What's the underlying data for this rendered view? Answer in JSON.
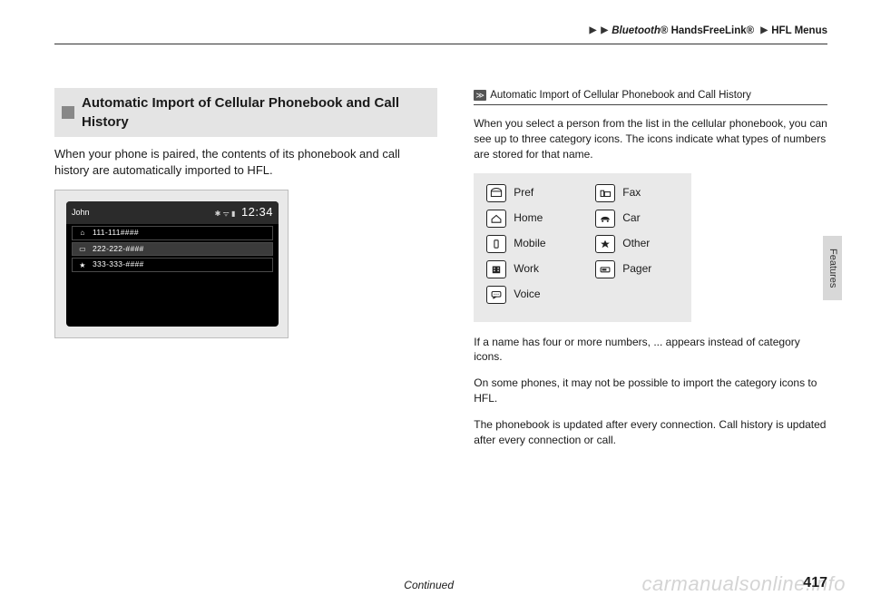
{
  "breadcrumb": {
    "a": "Bluetooth",
    "a_reg": "®",
    "b": "HandsFreeLink",
    "b_reg": "®",
    "c": "HFL Menus"
  },
  "section": {
    "title": "Automatic Import of Cellular Phonebook and Call History",
    "body": "When your phone is paired, the contents of its phonebook and call history are automatically imported to HFL."
  },
  "screen": {
    "name": "John",
    "status_icons": "✱ ᯤ ▮",
    "time": "12:34",
    "entries": [
      {
        "icon": "⌂",
        "num": "111-111####"
      },
      {
        "icon": "▭",
        "num": "222-222-####"
      },
      {
        "icon": "★",
        "num": "333-333-####"
      }
    ]
  },
  "sidebar": {
    "head": "Automatic Import of Cellular Phonebook and Call History",
    "p1": "When you select a person from the list in the cellular phonebook, you can see up to three category icons. The icons indicate what types of numbers are stored for that name.",
    "icons": {
      "pref": "Pref",
      "home": "Home",
      "mobile": "Mobile",
      "work": "Work",
      "voice": "Voice",
      "fax": "Fax",
      "car": "Car",
      "other": "Other",
      "pager": "Pager"
    },
    "p2": "If a name has four or more numbers, ... appears instead of category icons.",
    "p3": "On some phones, it may not be possible to import the category icons to HFL.",
    "p4": "The phonebook is updated after every connection. Call history is updated after every connection or call."
  },
  "side_tab": "Features",
  "footer": {
    "continued": "Continued",
    "page": "417"
  },
  "watermark": "carmanualsonline.info"
}
